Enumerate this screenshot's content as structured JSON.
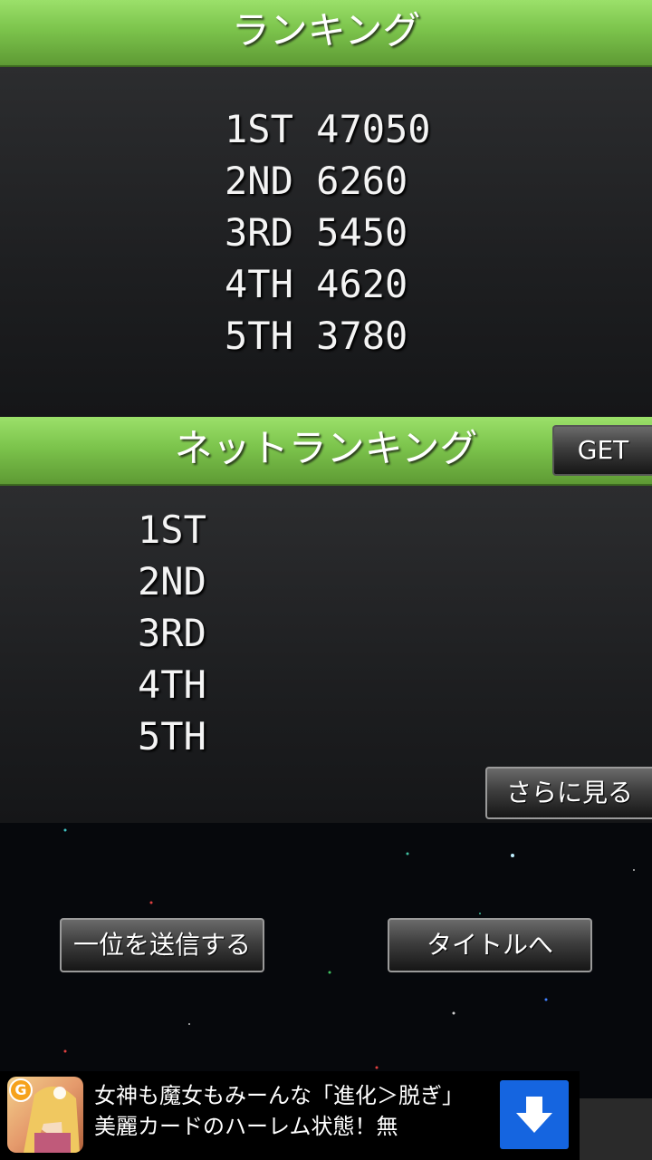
{
  "local_ranking": {
    "title": "ランキング",
    "entries": [
      {
        "rank": "1ST",
        "score": "47050"
      },
      {
        "rank": "2ND",
        "score": "6260"
      },
      {
        "rank": "3RD",
        "score": "5450"
      },
      {
        "rank": "4TH",
        "score": "4620"
      },
      {
        "rank": "5TH",
        "score": "3780"
      }
    ]
  },
  "net_ranking": {
    "title": "ネットランキング",
    "get_label": "GET",
    "entries": [
      {
        "rank": "1ST"
      },
      {
        "rank": "2ND"
      },
      {
        "rank": "3RD"
      },
      {
        "rank": "4TH"
      },
      {
        "rank": "5TH"
      }
    ],
    "more_label": "さらに見る"
  },
  "actions": {
    "send_first_label": "一位を送信する",
    "to_title_label": "タイトルへ"
  },
  "ad": {
    "text": "女神も魔女もみーんな「進化＞脱ぎ」 美麗カードのハーレム状態！無",
    "logo_letter": "G",
    "download_icon": "download-arrow-icon",
    "accent_color": "#1565e0"
  }
}
